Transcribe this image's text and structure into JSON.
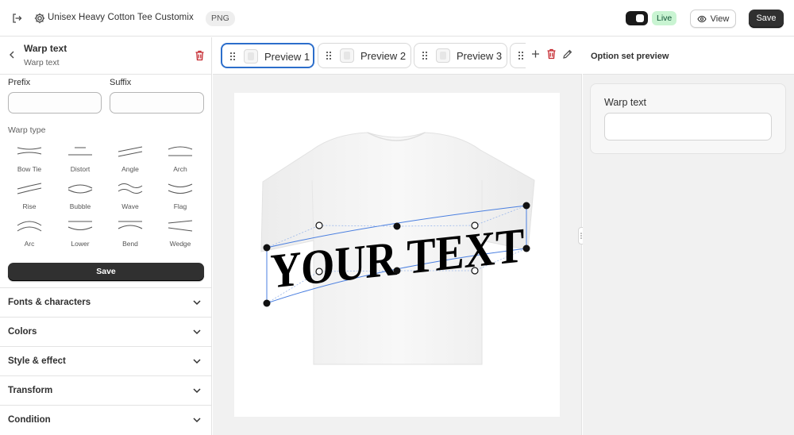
{
  "header": {
    "app_title": "Unisex Heavy Cotton Tee Customix",
    "format_badge": "PNG",
    "status_badge": "Live",
    "view_label": "View",
    "save_label": "Save"
  },
  "left_panel": {
    "title": "Warp text",
    "subtitle": "Warp text",
    "prefix_label": "Prefix",
    "prefix_value": "",
    "suffix_label": "Suffix",
    "suffix_value": "",
    "warp_type_label": "Warp type",
    "warp_types": [
      {
        "label": "Bow Tie",
        "icon": "bow-tie-icon"
      },
      {
        "label": "Distort",
        "icon": "distort-icon"
      },
      {
        "label": "Angle",
        "icon": "angle-icon"
      },
      {
        "label": "Arch",
        "icon": "arch-icon"
      },
      {
        "label": "Rise",
        "icon": "rise-icon"
      },
      {
        "label": "Bubble",
        "icon": "bubble-icon"
      },
      {
        "label": "Wave",
        "icon": "wave-icon"
      },
      {
        "label": "Flag",
        "icon": "flag-icon"
      },
      {
        "label": "Arc",
        "icon": "arc-icon"
      },
      {
        "label": "Lower",
        "icon": "lower-icon"
      },
      {
        "label": "Bend",
        "icon": "bend-icon"
      },
      {
        "label": "Wedge",
        "icon": "wedge-icon"
      }
    ],
    "save_label": "Save",
    "sections": [
      {
        "label": "Fonts & characters"
      },
      {
        "label": "Colors"
      },
      {
        "label": "Style & effect"
      },
      {
        "label": "Transform"
      },
      {
        "label": "Condition"
      }
    ]
  },
  "preview_tabs": [
    {
      "label": "Preview 1",
      "active": true
    },
    {
      "label": "Preview 2",
      "active": false
    },
    {
      "label": "Preview 3",
      "active": false
    }
  ],
  "canvas": {
    "text": "YOUR TEXT",
    "selection_color": "#4a7fe0"
  },
  "right_panel": {
    "title": "Option set preview",
    "field_label": "Warp text",
    "field_value": ""
  },
  "colors": {
    "active_tab": "#2c6ecb",
    "live_badge_bg": "#c9f4d2",
    "danger": "#c5282f",
    "primary_button": "#303030"
  }
}
